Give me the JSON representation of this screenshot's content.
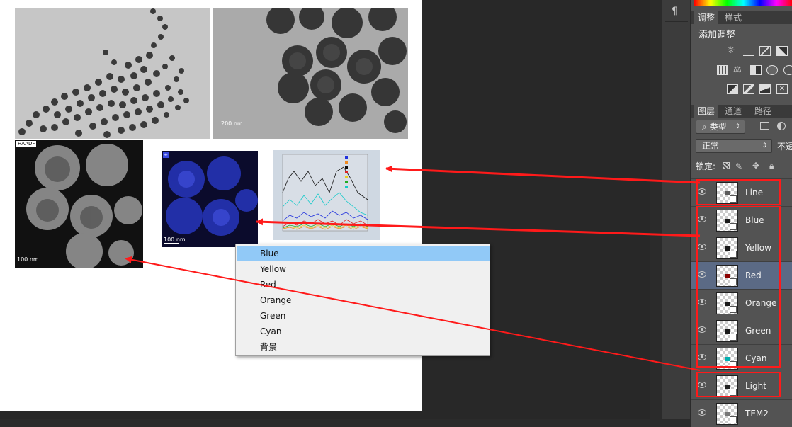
{
  "document": {
    "image_top_right_scalebar": "200 nm",
    "haadf_label": "HAADF",
    "haadf_scalebar": "100 nm",
    "eds_scalebar": "100 nm",
    "eds_panel_label": "+"
  },
  "right_column_symbol": "¶",
  "adjustments_panel": {
    "tabs": [
      "调整",
      "样式"
    ],
    "heading": "添加调整"
  },
  "layers_panel": {
    "tabs": [
      "图层",
      "通道",
      "路径"
    ],
    "filter_label": "类型",
    "blend_mode": "正常",
    "opacity_label": "不透",
    "lock_label": "锁定:",
    "layers": [
      {
        "name": "Line",
        "color": "#5a5a5a"
      },
      {
        "name": "Blue",
        "color": "#1a1a1a"
      },
      {
        "name": "Yellow",
        "color": "#1a1a1a"
      },
      {
        "name": "Red",
        "color": "#8b0000"
      },
      {
        "name": "Orange",
        "color": "#1a1a1a"
      },
      {
        "name": "Green",
        "color": "#1a1a1a"
      },
      {
        "name": "Cyan",
        "color": "#00b0b0"
      },
      {
        "name": "Light",
        "color": "#222222"
      },
      {
        "name": "TEM2",
        "color": "#777777"
      }
    ],
    "selected_layer": "Red"
  },
  "context_menu": {
    "items": [
      "Blue",
      "Yellow",
      "Red",
      "Orange",
      "Green",
      "Cyan",
      "背景"
    ],
    "highlighted": "Blue"
  },
  "annotation_color": "#ff1a1a"
}
